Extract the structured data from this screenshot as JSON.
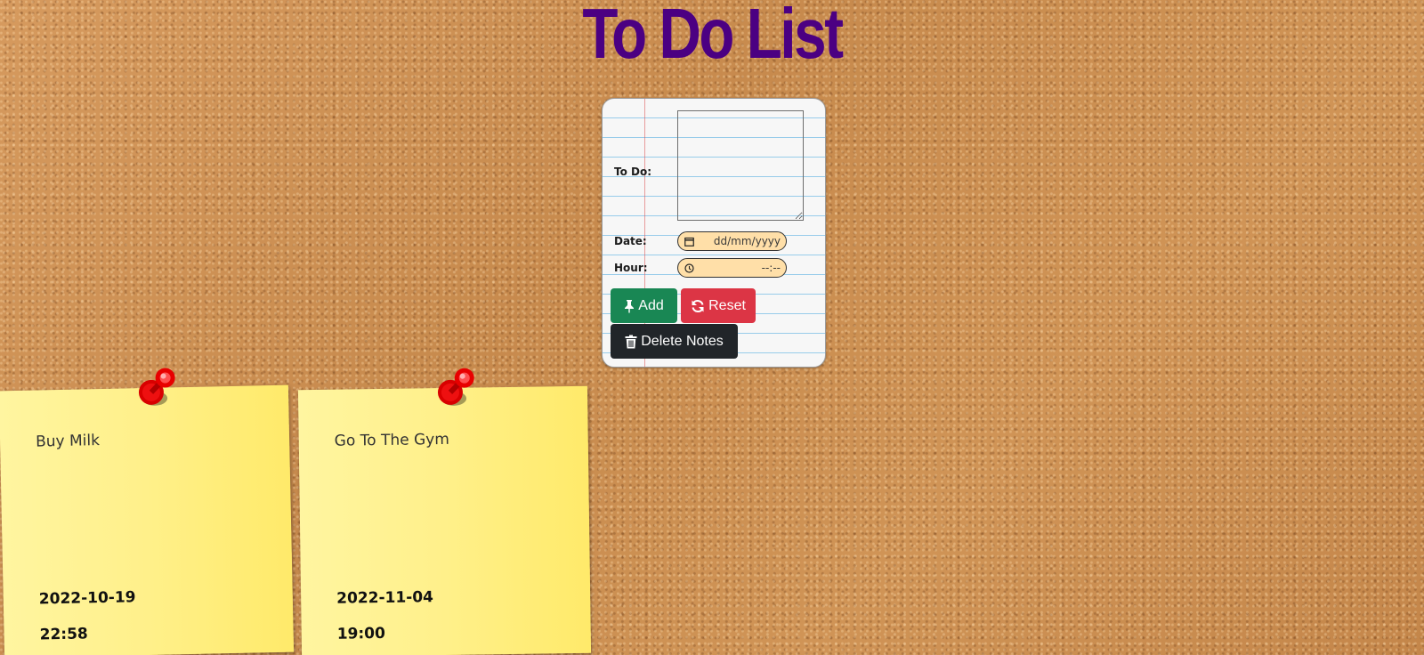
{
  "header": {
    "title": "To Do List"
  },
  "form": {
    "todo_label": "To Do:",
    "todo_value": "",
    "date_label": "Date:",
    "date_value": "dd/mm/yyyy",
    "hour_label": "Hour:",
    "hour_value": "--:--",
    "add_label": "Add",
    "reset_label": "Reset",
    "delete_label": "Delete Notes",
    "icons": {
      "add": "pushpin-icon",
      "reset": "refresh-icon",
      "delete": "trash-icon",
      "date": "calendar-icon",
      "hour": "clock-icon"
    }
  },
  "notes": [
    {
      "text": "Buy Milk",
      "date": "2022-10-19",
      "time": "22:58"
    },
    {
      "text": "Go To The Gym",
      "date": "2022-11-04",
      "time": "19:00"
    }
  ],
  "colors": {
    "title": "#4b0082",
    "add_button": "#198754",
    "reset_button": "#dc3545",
    "delete_button": "#212529",
    "input_background": "#ffdfa8",
    "note_background": "#fff08a",
    "pin": "#e00000"
  }
}
